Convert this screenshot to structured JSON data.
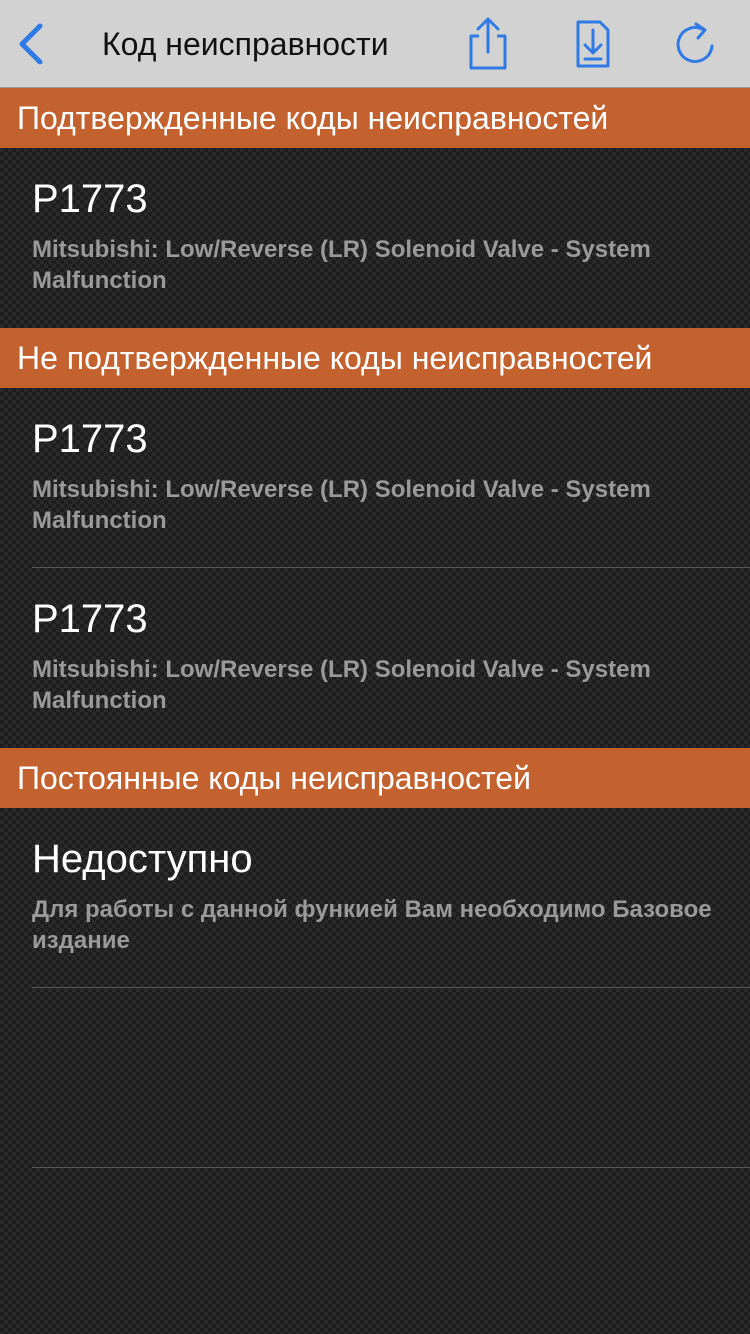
{
  "nav": {
    "title": "Код неисправности",
    "back_icon": "chevron-left-icon",
    "share_icon": "share-icon",
    "download_icon": "download-icon",
    "refresh_icon": "refresh-icon",
    "accent_color": "#2f7ae5"
  },
  "sections": [
    {
      "header": "Подтвержденные коды неисправностей",
      "items": [
        {
          "code": "P1773",
          "description": "Mitsubishi: Low/Reverse (LR) Solenoid Valve - System Malfunction"
        }
      ]
    },
    {
      "header": "Не подтвержденные коды неисправностей",
      "items": [
        {
          "code": "P1773",
          "description": "Mitsubishi: Low/Reverse (LR) Solenoid Valve - System Malfunction"
        },
        {
          "code": "P1773",
          "description": "Mitsubishi: Low/Reverse (LR) Solenoid Valve - System Malfunction"
        }
      ]
    },
    {
      "header": "Постоянные коды неисправностей",
      "items": [
        {
          "code": "Недоступно",
          "description": "Для работы с данной функией Вам необходимо Базовое издание"
        }
      ]
    }
  ],
  "colors": {
    "section_header_bg": "#c4622f",
    "navbar_bg": "#d2d2d2"
  }
}
